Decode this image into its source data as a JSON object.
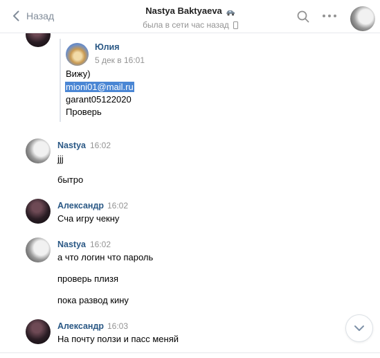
{
  "header": {
    "back_label": "Назад",
    "title": "Nastya Baktyaeva",
    "status": "была в сети час назад",
    "icons": [
      "chevron-left-icon",
      "car-icon",
      "phone-icon",
      "search-icon",
      "more-icon"
    ]
  },
  "top_partial_text": "",
  "forwarded": {
    "author": "Юлия",
    "date": "5 дек в 16:01",
    "lines": [
      "Вижу)",
      "mioni01@mail.ru",
      "garant05122020",
      "Проверь"
    ]
  },
  "messages": [
    {
      "author": "Nastya",
      "time": "16:02",
      "texts": [
        "jjj",
        "бытро"
      ]
    },
    {
      "author": "Александр",
      "time": "16:02",
      "texts": [
        "Сча игру чекну"
      ]
    },
    {
      "author": "Nastya",
      "time": "16:02",
      "texts": [
        "а что логин что пароль",
        "проверь плизя",
        "пока развод кину"
      ]
    },
    {
      "author": "Александр",
      "time": "16:03",
      "texts": [
        "На почту ползи и пасс меняй"
      ]
    }
  ],
  "colors": {
    "link": "#2a5885",
    "meta": "#939393",
    "highlight": "#4a86d4",
    "divider": "#e7e8ec"
  }
}
